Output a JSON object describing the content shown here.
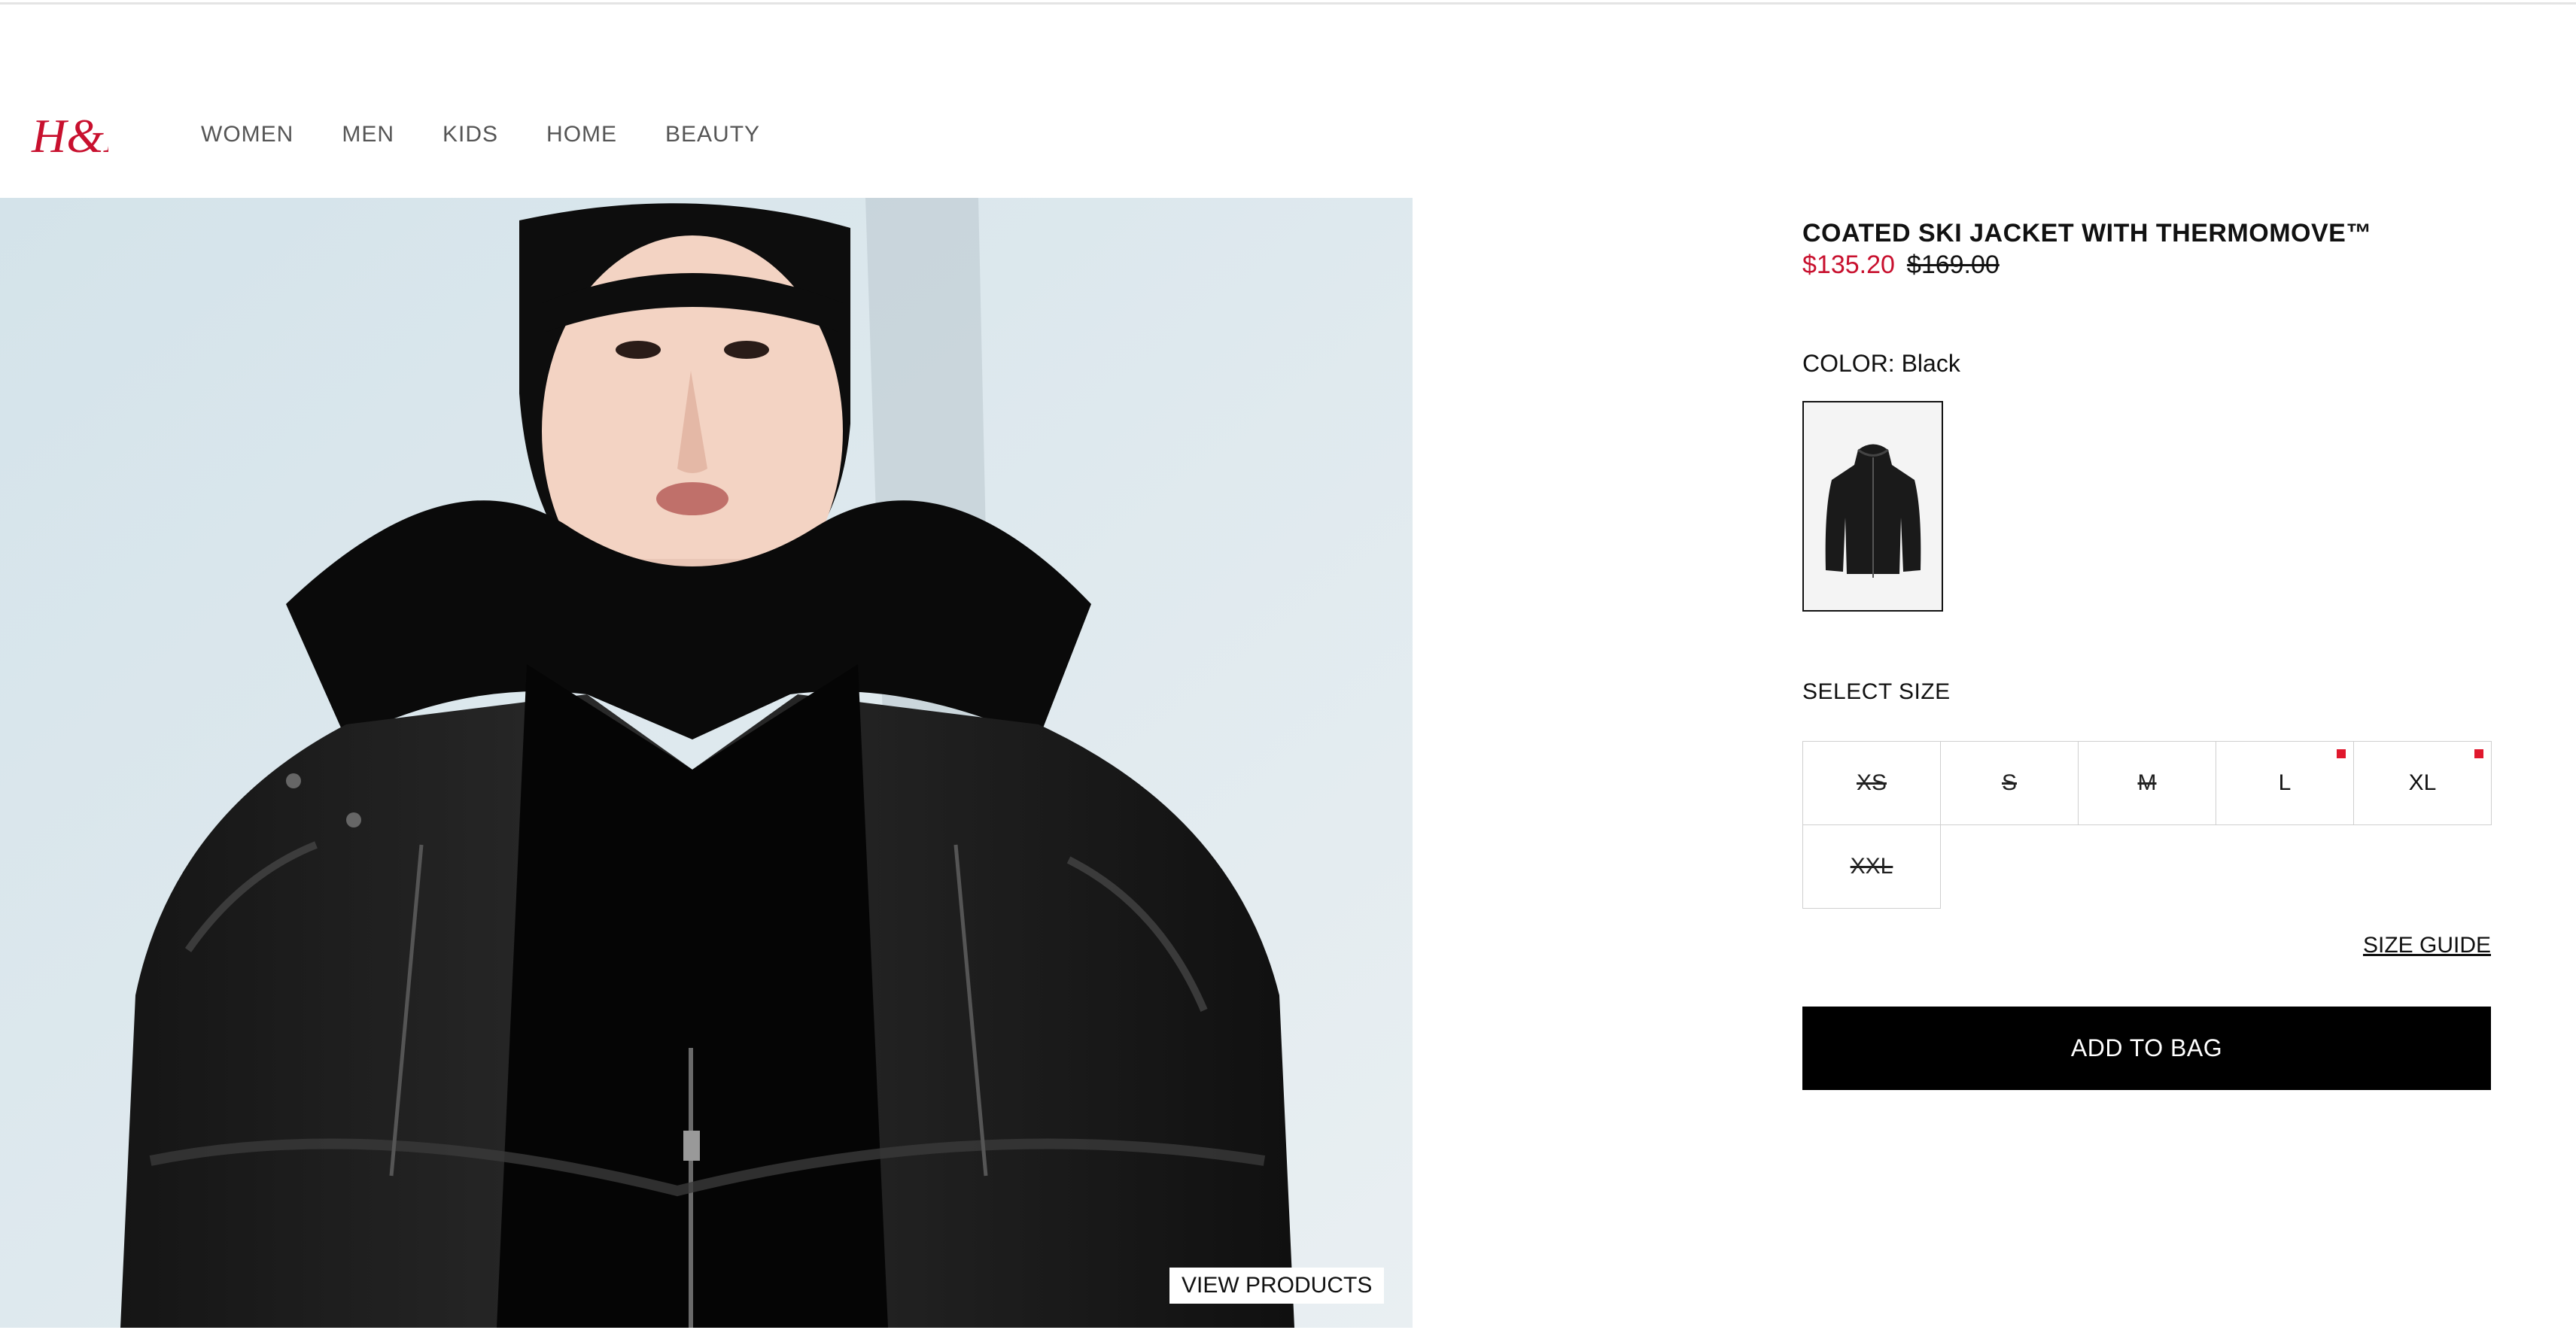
{
  "brand": {
    "logo_text": "H&M",
    "logo_color": "#c8102e"
  },
  "nav": {
    "items": [
      {
        "label": "WOMEN"
      },
      {
        "label": "MEN"
      },
      {
        "label": "KIDS"
      },
      {
        "label": "HOME"
      },
      {
        "label": "BEAUTY"
      }
    ]
  },
  "hero": {
    "view_products_label": "VIEW PRODUCTS"
  },
  "product": {
    "title": "COATED SKI JACKET WITH THERMOMOVE™",
    "sale_price": "$135.20",
    "original_price": "$169.00",
    "color_label": "COLOR: Black",
    "select_size_label": "SELECT SIZE",
    "sizes": [
      {
        "label": "XS",
        "available": false,
        "low_stock": false
      },
      {
        "label": "S",
        "available": false,
        "low_stock": false
      },
      {
        "label": "M",
        "available": false,
        "low_stock": false
      },
      {
        "label": "L",
        "available": true,
        "low_stock": true
      },
      {
        "label": "XL",
        "available": true,
        "low_stock": true
      },
      {
        "label": "XXL",
        "available": false,
        "low_stock": false
      }
    ],
    "size_guide_label": "SIZE GUIDE",
    "add_to_bag_label": "ADD TO BAG"
  },
  "colors": {
    "accent": "#c8102e",
    "low_stock_dot": "#e0182d",
    "button_bg": "#000000"
  }
}
